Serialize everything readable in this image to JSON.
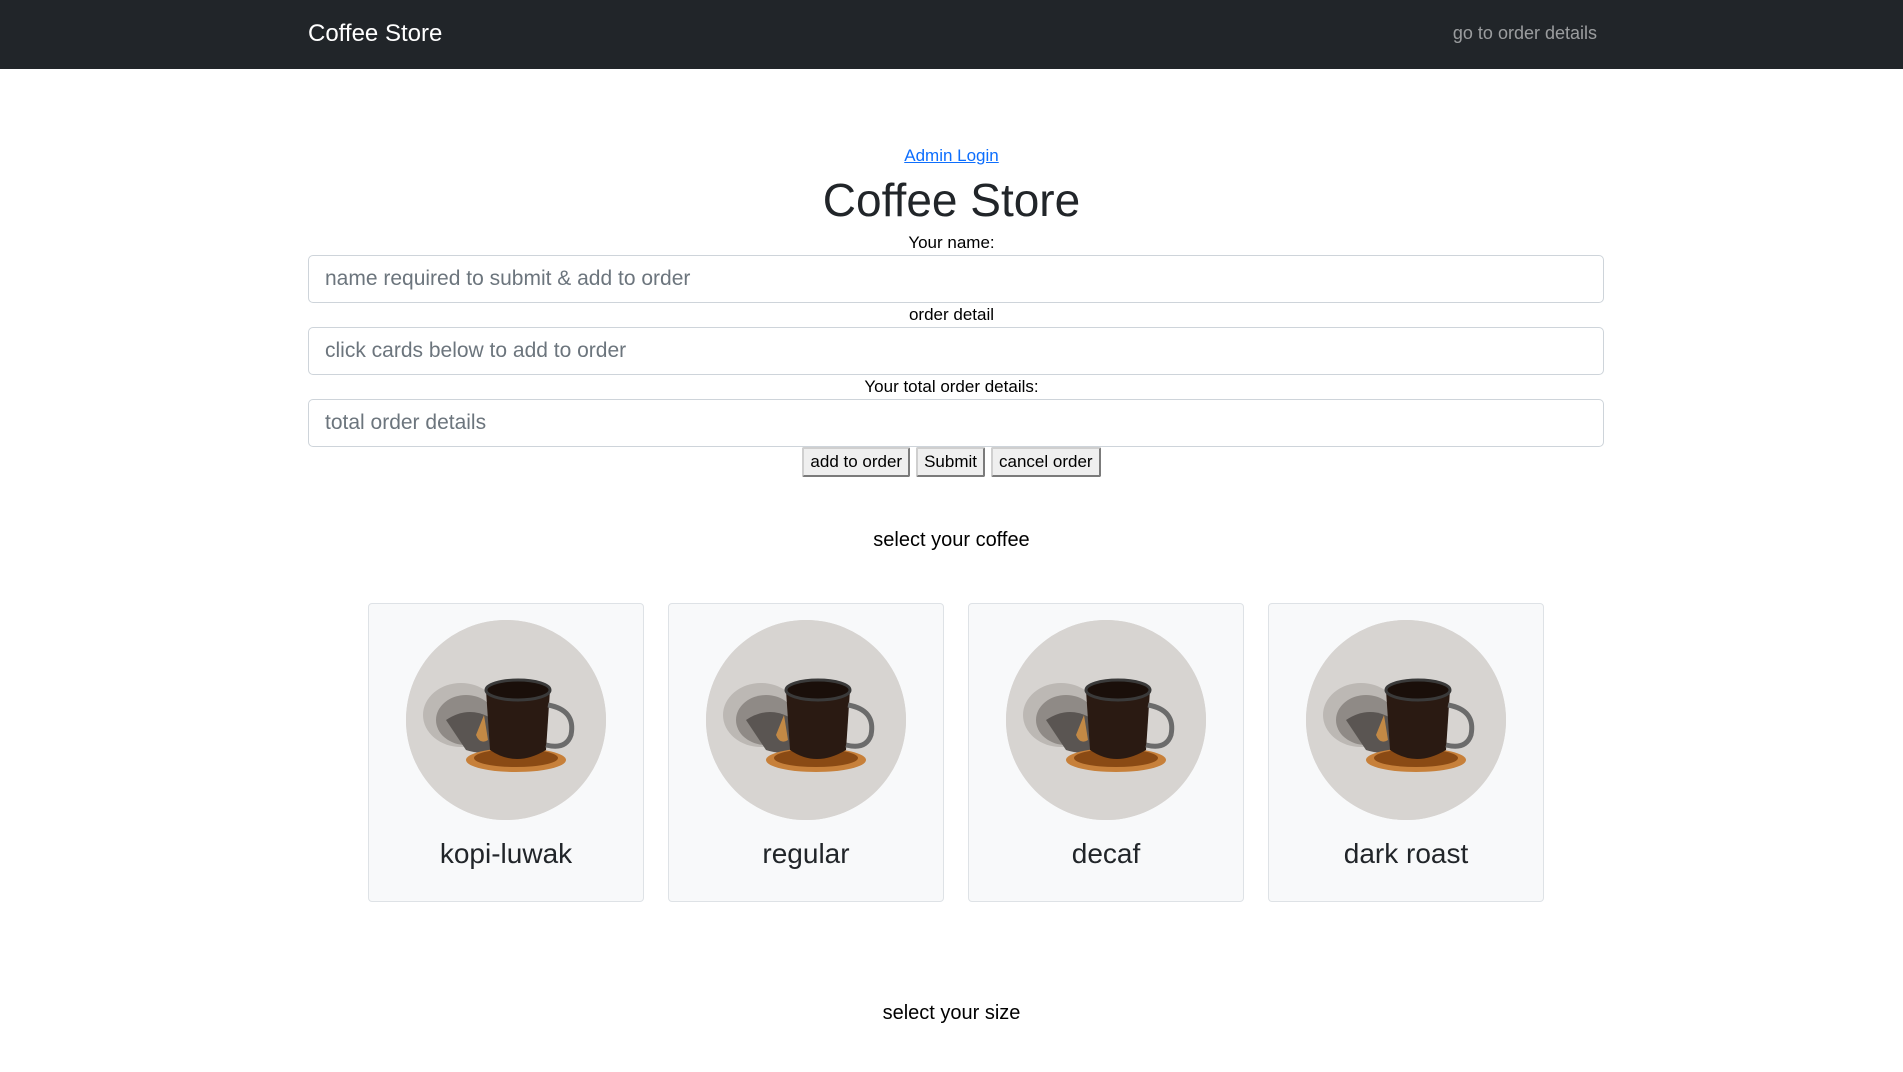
{
  "navbar": {
    "brand": "Coffee Store",
    "link": "go to order details"
  },
  "admin_link": "Admin Login",
  "title": "Coffee Store",
  "form": {
    "name_label": "Your name:",
    "name_placeholder": "name required to submit & add to order",
    "order_label": "order detail",
    "order_placeholder": "click cards below to add to order",
    "total_label": "Your total order details:",
    "total_placeholder": "total order details"
  },
  "buttons": {
    "add": "add to order",
    "submit": "Submit",
    "cancel": "cancel order"
  },
  "coffee_section": "select your coffee",
  "coffees": [
    {
      "name": "kopi-luwak",
      "image": "coffee-cup-image"
    },
    {
      "name": "regular",
      "image": "coffee-cup-image"
    },
    {
      "name": "decaf",
      "image": "coffee-cup-image"
    },
    {
      "name": "dark roast",
      "image": "coffee-cup-image"
    }
  ],
  "size_section": "select your size",
  "colors": {
    "navbar_bg": "#212529",
    "link": "#0d6efd",
    "card_bg": "#f8f9fa"
  }
}
